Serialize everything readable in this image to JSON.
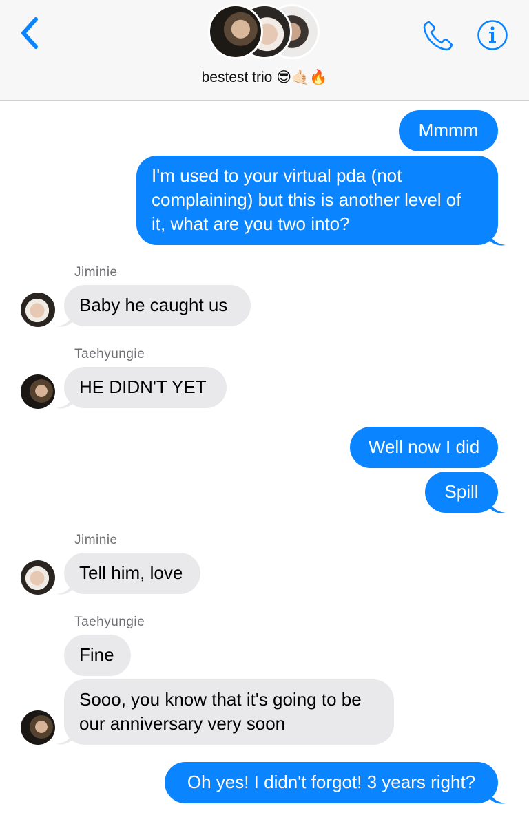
{
  "header": {
    "group_name": "bestest trio",
    "group_emoji": "😎🤙🏻🔥",
    "back_icon": "chevron-left-icon",
    "call_icon": "phone-icon",
    "info_icon": "info-icon",
    "accent_color": "#0b84ff"
  },
  "messages": [
    {
      "from": "me",
      "text": "Mmmm"
    },
    {
      "from": "me",
      "lines": [
        "I'm used to your virtual pda (not",
        "complaining) but this is another level of",
        "it, what are you two into?"
      ]
    },
    {
      "sender_label": "Jiminie"
    },
    {
      "from": "Jiminie",
      "text": "Baby he caught us"
    },
    {
      "sender_label": "Taehyungie"
    },
    {
      "from": "Taehyungie",
      "text": "HE DIDN'T YET"
    },
    {
      "from": "me",
      "text": "Well now I did"
    },
    {
      "from": "me",
      "text": "Spill"
    },
    {
      "sender_label": "Jiminie"
    },
    {
      "from": "Jiminie",
      "text": "Tell him, love"
    },
    {
      "sender_label": "Taehyungie"
    },
    {
      "from": "Taehyungie",
      "text": "Fine"
    },
    {
      "from": "Taehyungie",
      "lines": [
        "Sooo, you know that it's going to be",
        "our anniversary very soon"
      ]
    },
    {
      "from": "me",
      "text": "Oh yes! I didn't forgot! 3 years right?"
    }
  ],
  "colors": {
    "outgoing_bubble": "#0b84ff",
    "incoming_bubble": "#e9e9eb"
  }
}
